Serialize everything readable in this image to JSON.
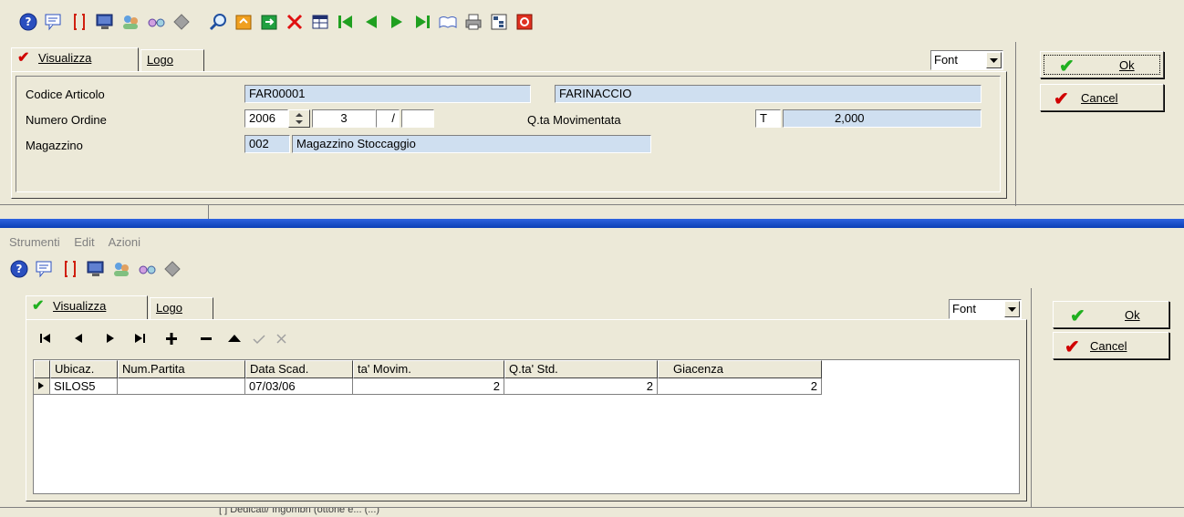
{
  "top": {
    "tabs": [
      {
        "label": "Visualizza",
        "accel": "V"
      },
      {
        "label": "Logo",
        "accel": "L"
      }
    ],
    "font_label": "Font",
    "fields": {
      "codice_articolo": {
        "label": "Codice Articolo",
        "code": "FAR00001",
        "description": "FARINACCIO"
      },
      "numero_ordine": {
        "label": "Numero Ordine",
        "year": "2006",
        "number": "3",
        "sep": "/",
        "suffix": ""
      },
      "qta_movimentata": {
        "label": "Q.ta Movimentata",
        "unit": "T",
        "value": "2,000"
      },
      "magazzino": {
        "label": "Magazzino",
        "code": "002",
        "description": "Magazzino Stoccaggio"
      }
    },
    "ok_label": "Ok",
    "cancel_label": "Cancel"
  },
  "bottom": {
    "menu": [
      "Strumenti",
      "Edit",
      "Azioni"
    ],
    "tabs": [
      {
        "label": "Visualizza",
        "accel": "V"
      },
      {
        "label": "Logo",
        "accel": "L"
      }
    ],
    "font_label": "Font",
    "ok_label": "Ok",
    "cancel_label": "Cancel",
    "grid": {
      "columns": [
        "Ubicaz.",
        "Num.Partita",
        "Data Scad.",
        "ta' Movim.",
        "Q.ta' Std.",
        "Giacenza"
      ],
      "rows": [
        [
          "SILOS5",
          "",
          "07/03/06",
          "2",
          "2",
          "2"
        ]
      ]
    },
    "status_text": "[ ] Dedicati/ Ingombri (ottone e... (...)"
  },
  "colors": {
    "field_bg": "#cfdff0",
    "titlebar": "#0a3fb5",
    "face": "#ece9d8"
  }
}
